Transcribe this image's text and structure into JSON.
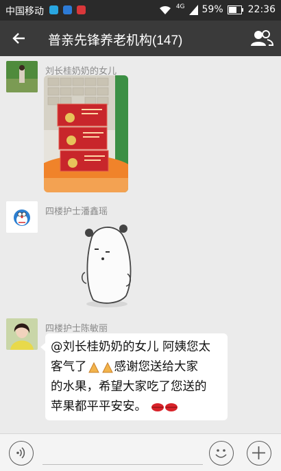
{
  "status": {
    "carrier": "中国移动",
    "network": "4G",
    "battery": "59%",
    "time": "22:36"
  },
  "header": {
    "title": "普亲先锋养老机构(147)"
  },
  "messages": [
    {
      "sender": "刘长桂奶奶的女儿",
      "type": "image"
    },
    {
      "sender": "四楼护士潘鑫瑶",
      "type": "sticker"
    },
    {
      "sender": "四楼护士陈敏丽",
      "type": "text",
      "lines": [
        "@刘长桂奶奶的女儿 阿姨您太",
        "客气了",
        "感谢您送给大家",
        "的水果，希望大家吃了您送的",
        "苹果都平平安安。"
      ]
    }
  ],
  "icons": {
    "back": "back-arrow-icon",
    "members": "group-members-icon",
    "voice": "voice-icon",
    "emoji": "emoji-icon",
    "plus": "plus-icon"
  }
}
